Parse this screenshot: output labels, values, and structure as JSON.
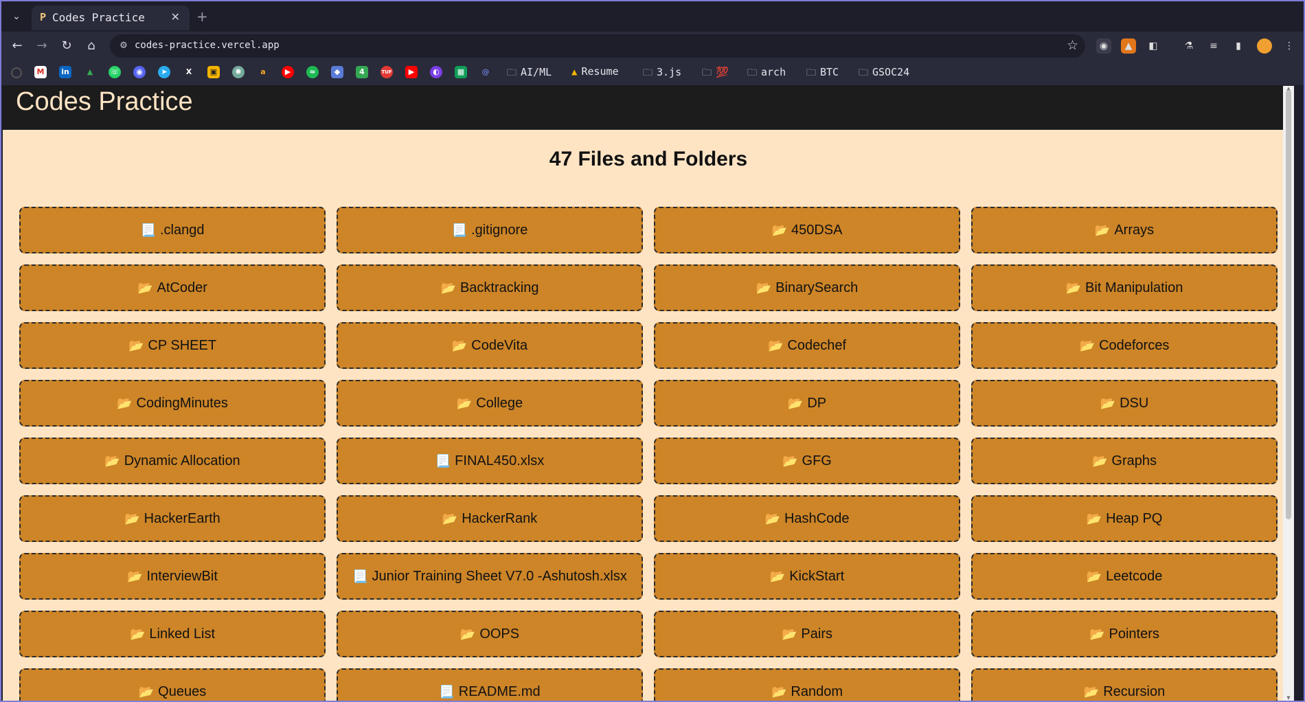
{
  "browser": {
    "tab_title": "Codes Practice",
    "tab_favicon": "P",
    "url": "codes-practice.vercel.app",
    "bookmark_folders": [
      "AI/ML",
      "Resume",
      "3.js",
      "💯",
      "arch",
      "BTC",
      "GSOC24"
    ]
  },
  "page": {
    "site_title": "Codes Practice",
    "heading": "47 Files and Folders"
  },
  "items": [
    {
      "name": ".clangd",
      "type": "file"
    },
    {
      "name": ".gitignore",
      "type": "file"
    },
    {
      "name": "450DSA",
      "type": "folder"
    },
    {
      "name": "Arrays",
      "type": "folder"
    },
    {
      "name": "AtCoder",
      "type": "folder"
    },
    {
      "name": "Backtracking",
      "type": "folder"
    },
    {
      "name": "BinarySearch",
      "type": "folder"
    },
    {
      "name": "Bit Manipulation",
      "type": "folder"
    },
    {
      "name": "CP SHEET",
      "type": "folder"
    },
    {
      "name": "CodeVita",
      "type": "folder"
    },
    {
      "name": "Codechef",
      "type": "folder"
    },
    {
      "name": "Codeforces",
      "type": "folder"
    },
    {
      "name": "CodingMinutes",
      "type": "folder"
    },
    {
      "name": "College",
      "type": "folder"
    },
    {
      "name": "DP",
      "type": "folder"
    },
    {
      "name": "DSU",
      "type": "folder"
    },
    {
      "name": "Dynamic Allocation",
      "type": "folder"
    },
    {
      "name": "FINAL450.xlsx",
      "type": "file"
    },
    {
      "name": "GFG",
      "type": "folder"
    },
    {
      "name": "Graphs",
      "type": "folder"
    },
    {
      "name": "HackerEarth",
      "type": "folder"
    },
    {
      "name": "HackerRank",
      "type": "folder"
    },
    {
      "name": "HashCode",
      "type": "folder"
    },
    {
      "name": "Heap PQ",
      "type": "folder"
    },
    {
      "name": "InterviewBit",
      "type": "folder"
    },
    {
      "name": "Junior Training Sheet V7.0 -Ashutosh.xlsx",
      "type": "file"
    },
    {
      "name": "KickStart",
      "type": "folder"
    },
    {
      "name": "Leetcode",
      "type": "folder"
    },
    {
      "name": "Linked List",
      "type": "folder"
    },
    {
      "name": "OOPS",
      "type": "folder"
    },
    {
      "name": "Pairs",
      "type": "folder"
    },
    {
      "name": "Pointers",
      "type": "folder"
    },
    {
      "name": "Queues",
      "type": "folder"
    },
    {
      "name": "README.md",
      "type": "file"
    },
    {
      "name": "Random",
      "type": "folder"
    },
    {
      "name": "Recursion",
      "type": "folder"
    }
  ],
  "icons": {
    "folder": "📂",
    "file": "📃"
  },
  "colors": {
    "card_bg": "#cd8528",
    "page_bg": "#ffe4c4",
    "header_bg": "#1c1c1c"
  }
}
